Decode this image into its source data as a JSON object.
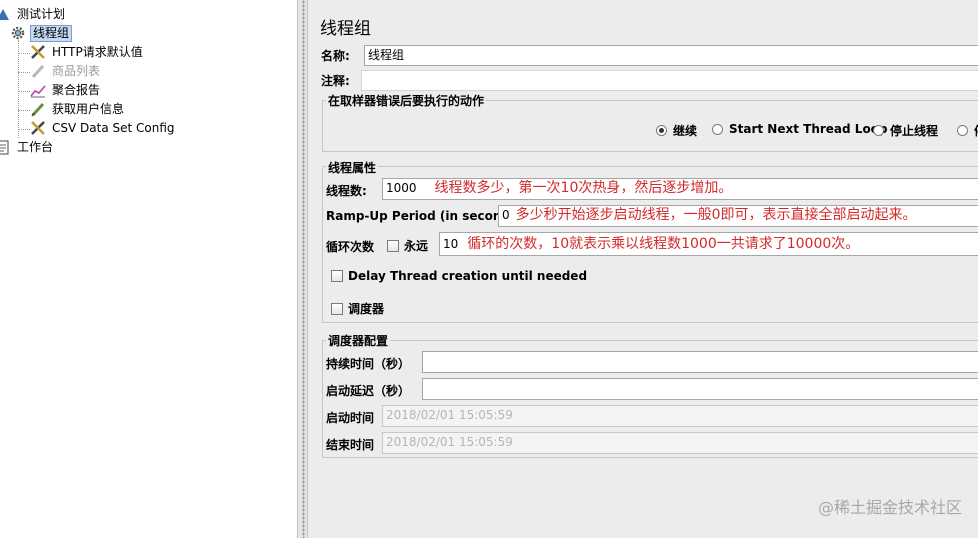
{
  "tree": {
    "items": [
      {
        "label": "测试计划",
        "icon": "test-plan-icon"
      },
      {
        "label": "线程组",
        "icon": "gear-icon"
      },
      {
        "label": "HTTP请求默认值",
        "icon": "wrench-icon"
      },
      {
        "label": "商品列表",
        "icon": "pencil-icon"
      },
      {
        "label": "聚合报告",
        "icon": "chart-icon"
      },
      {
        "label": "获取用户信息",
        "icon": "pencil-icon"
      },
      {
        "label": "CSV Data Set Config",
        "icon": "wrench-icon"
      },
      {
        "label": "工作台",
        "icon": "clipboard-icon"
      }
    ]
  },
  "panel": {
    "title": "线程组",
    "name_label": "名称:",
    "name_value": "线程组",
    "comment_label": "注释:",
    "comment_value": ""
  },
  "sampler_error": {
    "title": "在取样器错误后要执行的动作",
    "options": [
      "继续",
      "Start Next Thread Loop",
      "停止线程",
      "停"
    ],
    "selected": "继续"
  },
  "thread_props": {
    "title": "线程属性",
    "threads_label": "线程数:",
    "threads_value": "1000",
    "threads_note": "线程数多少，第一次10次热身，然后逐步增加。",
    "rampup_label": "Ramp-Up Period (in seconds):",
    "rampup_value": "0",
    "rampup_note": "多少秒开始逐步启动线程，一般0即可，表示直接全部启动起来。",
    "loop_label": "循环次数",
    "forever_label": "永远",
    "loop_value": "10",
    "loop_note": "循环的次数，10就表示乘以线程数1000一共请求了10000次。",
    "delay_label": "Delay Thread creation until needed",
    "scheduler_label": "调度器"
  },
  "scheduler": {
    "title": "调度器配置",
    "duration_label": "持续时间（秒）",
    "duration_value": "",
    "delay_label": "启动延迟（秒）",
    "delay_value": "",
    "start_label": "启动时间",
    "start_value": "2018/02/01 15:05:59",
    "end_label": "结束时间",
    "end_value": "2018/02/01 15:05:59"
  },
  "watermark": "@稀土掘金技术社区"
}
